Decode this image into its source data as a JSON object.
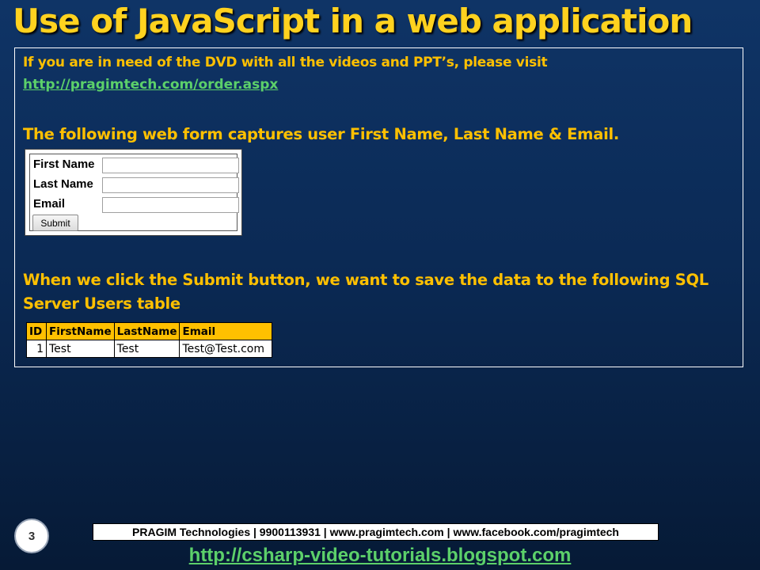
{
  "slide": {
    "title": "Use of JavaScript in a web application",
    "intro_text": "If you are in need of the DVD with all the videos and PPT’s, please visit",
    "intro_link": "http://pragimtech.com/order.aspx",
    "form_description": "The following web form captures user First Name, Last Name & Email.",
    "submit_description": "When we click the Submit button, we want to save the data to the following SQL Server Users table"
  },
  "web_form": {
    "fields": [
      {
        "label": "First Name",
        "value": ""
      },
      {
        "label": "Last Name",
        "value": ""
      },
      {
        "label": "Email",
        "value": ""
      }
    ],
    "submit_label": "Submit"
  },
  "users_table": {
    "headers": [
      "ID",
      "FirstName",
      "LastName",
      "Email"
    ],
    "rows": [
      [
        "1",
        "Test",
        "Test",
        "Test@Test.com"
      ]
    ],
    "header_color": "#ffc000"
  },
  "footer": {
    "page_number": "3",
    "company_info": "PRAGIM Technologies | 9900113931 | www.pragimtech.com | www.facebook.com/pragimtech",
    "blog_link": "http://csharp-video-tutorials.blogspot.com"
  },
  "colors": {
    "title": "#ffd21f",
    "body_text": "#ffc000",
    "link": "#5cd06a",
    "background_top": "#0f3466",
    "background_bottom": "#061a36"
  }
}
